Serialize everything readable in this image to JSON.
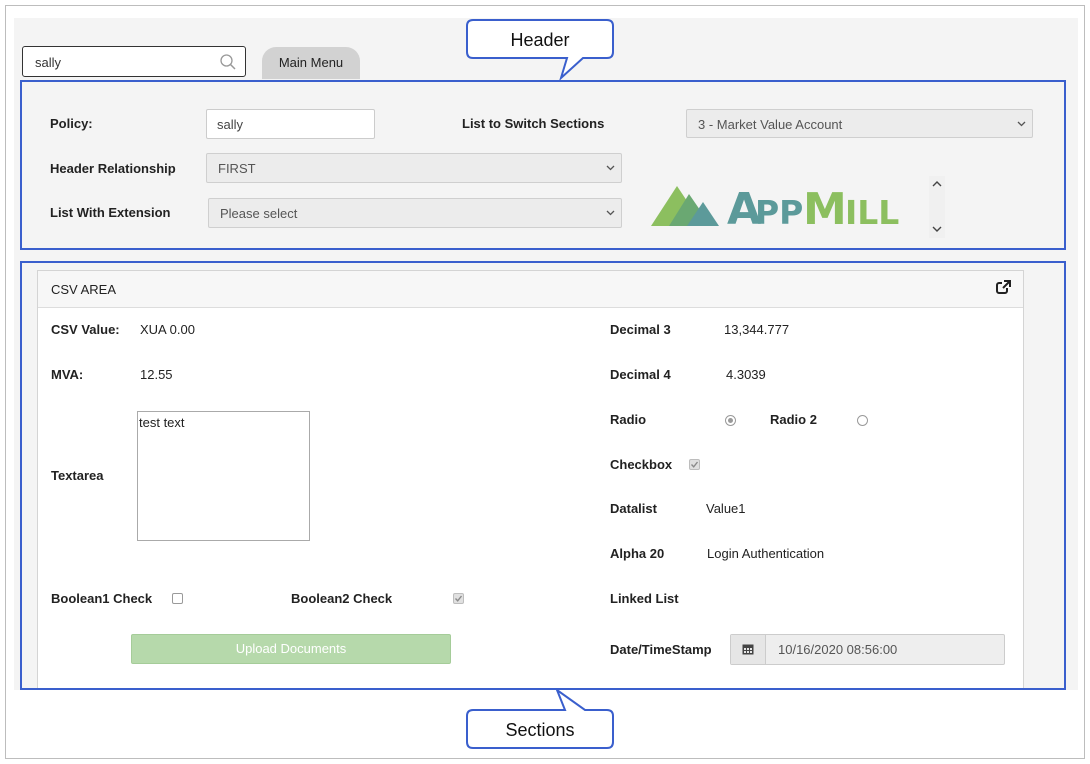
{
  "search": {
    "value": "sally"
  },
  "nav": {
    "main_menu": "Main Menu"
  },
  "callouts": {
    "header": "Header",
    "sections": "Sections"
  },
  "header": {
    "policy_label": "Policy:",
    "policy_value": "sally",
    "switch_label": "List to Switch Sections",
    "switch_value": "3 - Market Value Account",
    "relationship_label": "Header Relationship",
    "relationship_value": "FIRST",
    "extension_label": "List With Extension",
    "extension_value": "Please select",
    "logo_text": "AppMill"
  },
  "csv": {
    "title": "CSV AREA",
    "csv_value_label": "CSV Value:",
    "csv_value": "XUA 0.00",
    "mva_label": "MVA:",
    "mva_value": "12.55",
    "textarea_label": "Textarea",
    "textarea_value": "test text",
    "boolean1_label": "Boolean1 Check",
    "boolean1_checked": false,
    "boolean2_label": "Boolean2 Check",
    "boolean2_checked": true,
    "upload_label": "Upload Documents",
    "decimal3_label": "Decimal 3",
    "decimal3_value": "13,344.777",
    "decimal4_label": "Decimal 4",
    "decimal4_value": "4.3039",
    "radio_label": "Radio",
    "radio_selected": true,
    "radio2_label": "Radio 2",
    "radio2_selected": false,
    "checkbox_label": "Checkbox",
    "checkbox_checked": true,
    "datalist_label": "Datalist",
    "datalist_value": "Value1",
    "alpha20_label": "Alpha 20",
    "alpha20_value": "Login Authentication",
    "linked_list_label": "Linked List",
    "datetime_label": "Date/TimeStamp",
    "datetime_value": "10/16/2020 08:56:00"
  },
  "colors": {
    "callout_border": "#3a5fcd",
    "upload_button": "#b6d9ab",
    "logo_green": "#8cbf5f",
    "logo_teal": "#5c9a9a"
  }
}
